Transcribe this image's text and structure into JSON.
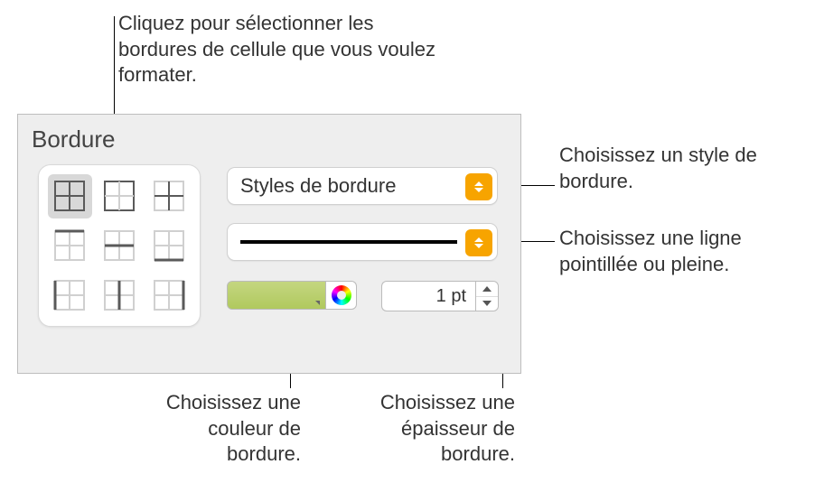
{
  "callouts": {
    "grid": "Cliquez pour sélectionner les bordures de cellule que vous voulez formater.",
    "style": "Choisissez un style de bordure.",
    "line": "Choisissez une ligne pointillée ou pleine.",
    "color": "Choisissez une couleur de bordure.",
    "thickness": "Choisissez une épaisseur de bordure."
  },
  "panel": {
    "section_label": "Bordure",
    "style_label": "Styles de bordure",
    "thickness_value": "1 pt",
    "color": "#b7cc63"
  }
}
